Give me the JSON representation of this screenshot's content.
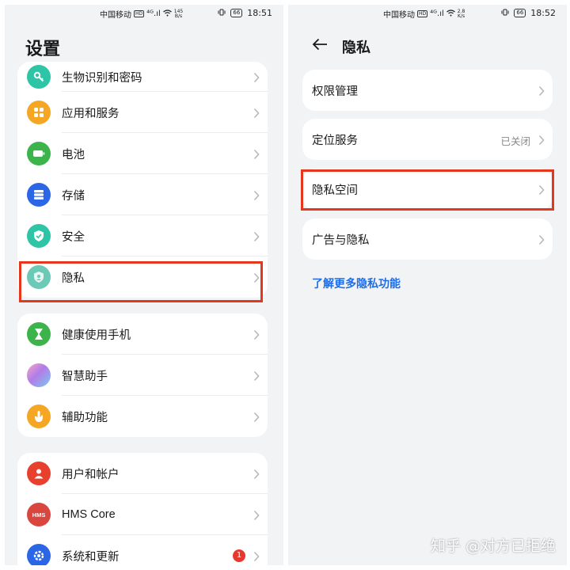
{
  "left": {
    "status": {
      "carrier": "中国移动",
      "hd": "HD",
      "signal": "⁴ᴳ.ıl",
      "speed_value": "145",
      "speed_unit": "B/s",
      "time": "18:51",
      "battery": "66"
    },
    "title": "设置",
    "groups": [
      [
        {
          "label": "生物识别和密码",
          "icon": "key-icon",
          "color": "#2ec4a6"
        },
        {
          "label": "应用和服务",
          "icon": "apps-grid-icon",
          "color": "#f5a623"
        },
        {
          "label": "电池",
          "icon": "battery-icon",
          "color": "#3cb44b"
        },
        {
          "label": "存储",
          "icon": "storage-icon",
          "color": "#2a66e6"
        },
        {
          "label": "安全",
          "icon": "shield-check-icon",
          "color": "#2ec4a6"
        },
        {
          "label": "隐私",
          "icon": "privacy-icon",
          "color": "#6bc9b5"
        }
      ],
      [
        {
          "label": "健康使用手机",
          "icon": "hourglass-icon",
          "color": "#3cb44b"
        },
        {
          "label": "智慧助手",
          "icon": "assistant-orb-icon",
          "color": "#b07de8"
        },
        {
          "label": "辅助功能",
          "icon": "hand-icon",
          "color": "#f5a623"
        }
      ],
      [
        {
          "label": "用户和帐户",
          "icon": "user-icon",
          "color": "#e8402e"
        },
        {
          "label": "HMS Core",
          "icon": "hms-icon",
          "color": "#d9453f",
          "icon_text": "HMS"
        },
        {
          "label": "系统和更新",
          "icon": "system-update-icon",
          "color": "#2a66e6",
          "badge": "1"
        }
      ]
    ]
  },
  "right": {
    "status": {
      "carrier": "中国移动",
      "hd": "HD",
      "signal": "⁴ᴳ.ıl",
      "speed_value": "2.8",
      "speed_unit": "K/s",
      "time": "18:52",
      "battery": "66"
    },
    "title": "隐私",
    "items": [
      {
        "label": "权限管理",
        "value": ""
      },
      {
        "label": "定位服务",
        "value": "已关闭"
      },
      {
        "label": "隐私空间",
        "value": ""
      },
      {
        "label": "广告与隐私",
        "value": ""
      }
    ],
    "link": "了解更多隐私功能"
  },
  "watermark": "知乎 @对方已拒绝",
  "colors": {
    "highlight": "#e5361e",
    "link": "#1e6de8",
    "background": "#f1f3f5"
  }
}
